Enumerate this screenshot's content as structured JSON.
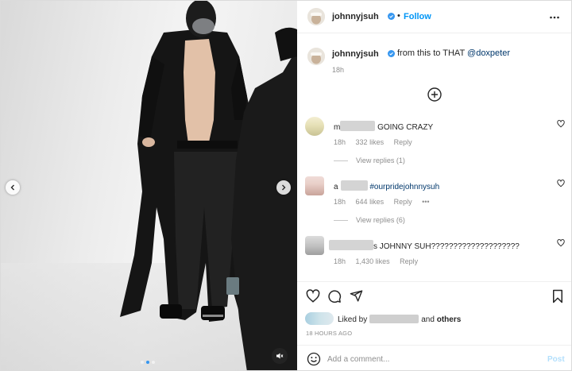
{
  "post": {
    "username": "johnnyjsuh",
    "follow_label": "Follow",
    "separator": "•",
    "caption": {
      "username": "johnnyjsuh",
      "text_before": "from this to THAT ",
      "mention": "@doxpeter",
      "time": "18h"
    }
  },
  "comments": [
    {
      "username_visible": "m",
      "text": " GOING CRAZY",
      "time": "18h",
      "likes": "332 likes",
      "reply_label": "Reply",
      "view_replies": "View replies (1)"
    },
    {
      "username_visible": "a",
      "text": " #ourpridejohnnysuh",
      "time": "18h",
      "likes": "644 likes",
      "reply_label": "Reply",
      "more": "•••",
      "view_replies": "View replies (6)"
    },
    {
      "username_visible": "",
      "text": "s JOHNNY SUH????????????????????",
      "time": "18h",
      "likes": "1,430 likes",
      "reply_label": "Reply"
    }
  ],
  "engagement": {
    "liked_by_prefix": "Liked by",
    "and_label": "and",
    "others_label": "others",
    "time_ago": "18 HOURS AGO"
  },
  "comment_box": {
    "placeholder": "Add a comment...",
    "post_label": "Post"
  },
  "carousel": {
    "total_slides": 3,
    "current_slide": 1
  },
  "colors": {
    "accent": "#0095f6",
    "link": "#00376b",
    "muted": "#8e8e8e",
    "verified": "#3797f0"
  },
  "icons": {
    "prev": "chevron-left-icon",
    "next": "chevron-right-icon",
    "mute": "speaker-muted-icon",
    "more": "more-horizontal-icon",
    "load_more": "plus-circle-icon",
    "like": "heart-icon",
    "comment": "comment-bubble-icon",
    "share": "paper-plane-icon",
    "save": "bookmark-icon",
    "emoji": "emoji-icon",
    "verified": "verified-badge-icon"
  }
}
